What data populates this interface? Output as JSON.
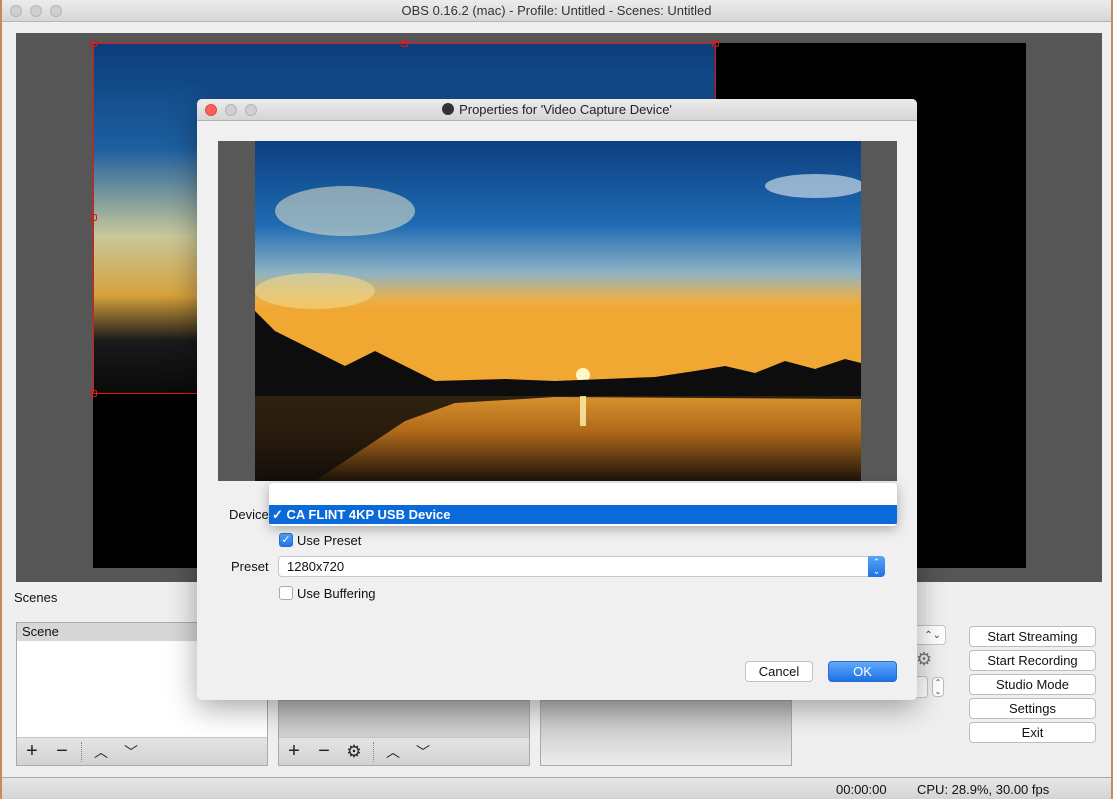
{
  "window": {
    "title": "OBS 0.16.2 (mac) - Profile: Untitled - Scenes: Untitled"
  },
  "main": {
    "scenes_label": "Scenes",
    "scenes_list": {
      "items": [
        "Scene"
      ]
    },
    "controls": {
      "start_streaming": "Start Streaming",
      "start_recording": "Start Recording",
      "studio_mode": "Studio Mode",
      "settings": "Settings",
      "exit": "Exit"
    }
  },
  "statusbar": {
    "time": "00:00:00",
    "cpu": "CPU: 28.9%, 30.00 fps"
  },
  "dialog": {
    "title": "Properties for 'Video Capture Device'",
    "device_label": "Device",
    "device_options": [
      "",
      "CA FLINT 4KP USB Device"
    ],
    "device_selected": "CA FLINT 4KP USB Device",
    "checkmark": "✓",
    "use_preset_label": "Use Preset",
    "use_preset_checked": true,
    "preset_label": "Preset",
    "preset_value": "1280x720",
    "use_buffering_label": "Use Buffering",
    "use_buffering_checked": false,
    "cancel_label": "Cancel",
    "ok_label": "OK"
  },
  "colors": {
    "accent_blue": "#1f74e6",
    "selection_red": "#e11111",
    "preview_bg": "#565656"
  }
}
